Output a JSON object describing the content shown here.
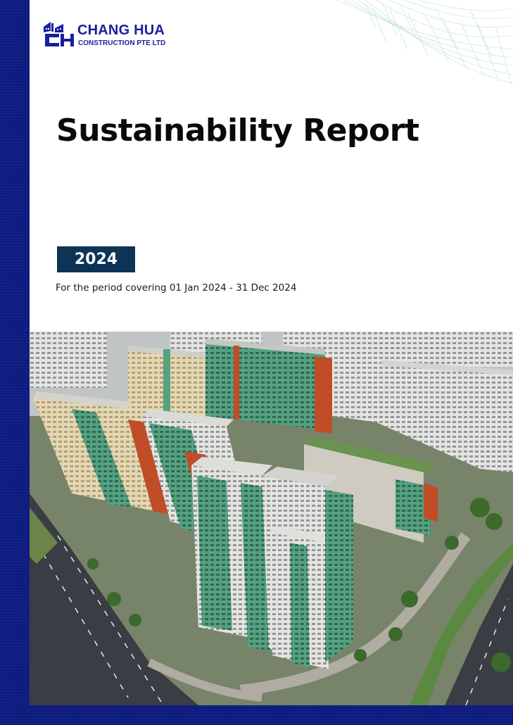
{
  "logo": {
    "name": "CHANG HUA",
    "subtitle": "CONSTRUCTION PTE LTD",
    "mark_text": "CH",
    "color": "#1b1f9e"
  },
  "report": {
    "title": "Sustainability Report",
    "year": "2024",
    "period": "For the period covering 01 Jan 2024 - 31 Dec 2024"
  },
  "cover_image": {
    "subject": "aerial-view-residential-blocks"
  },
  "colors": {
    "side_band": "#0d1a7e",
    "year_badge": "#0d3457",
    "building_green": "#4fa07f",
    "building_orange": "#c9502a"
  }
}
